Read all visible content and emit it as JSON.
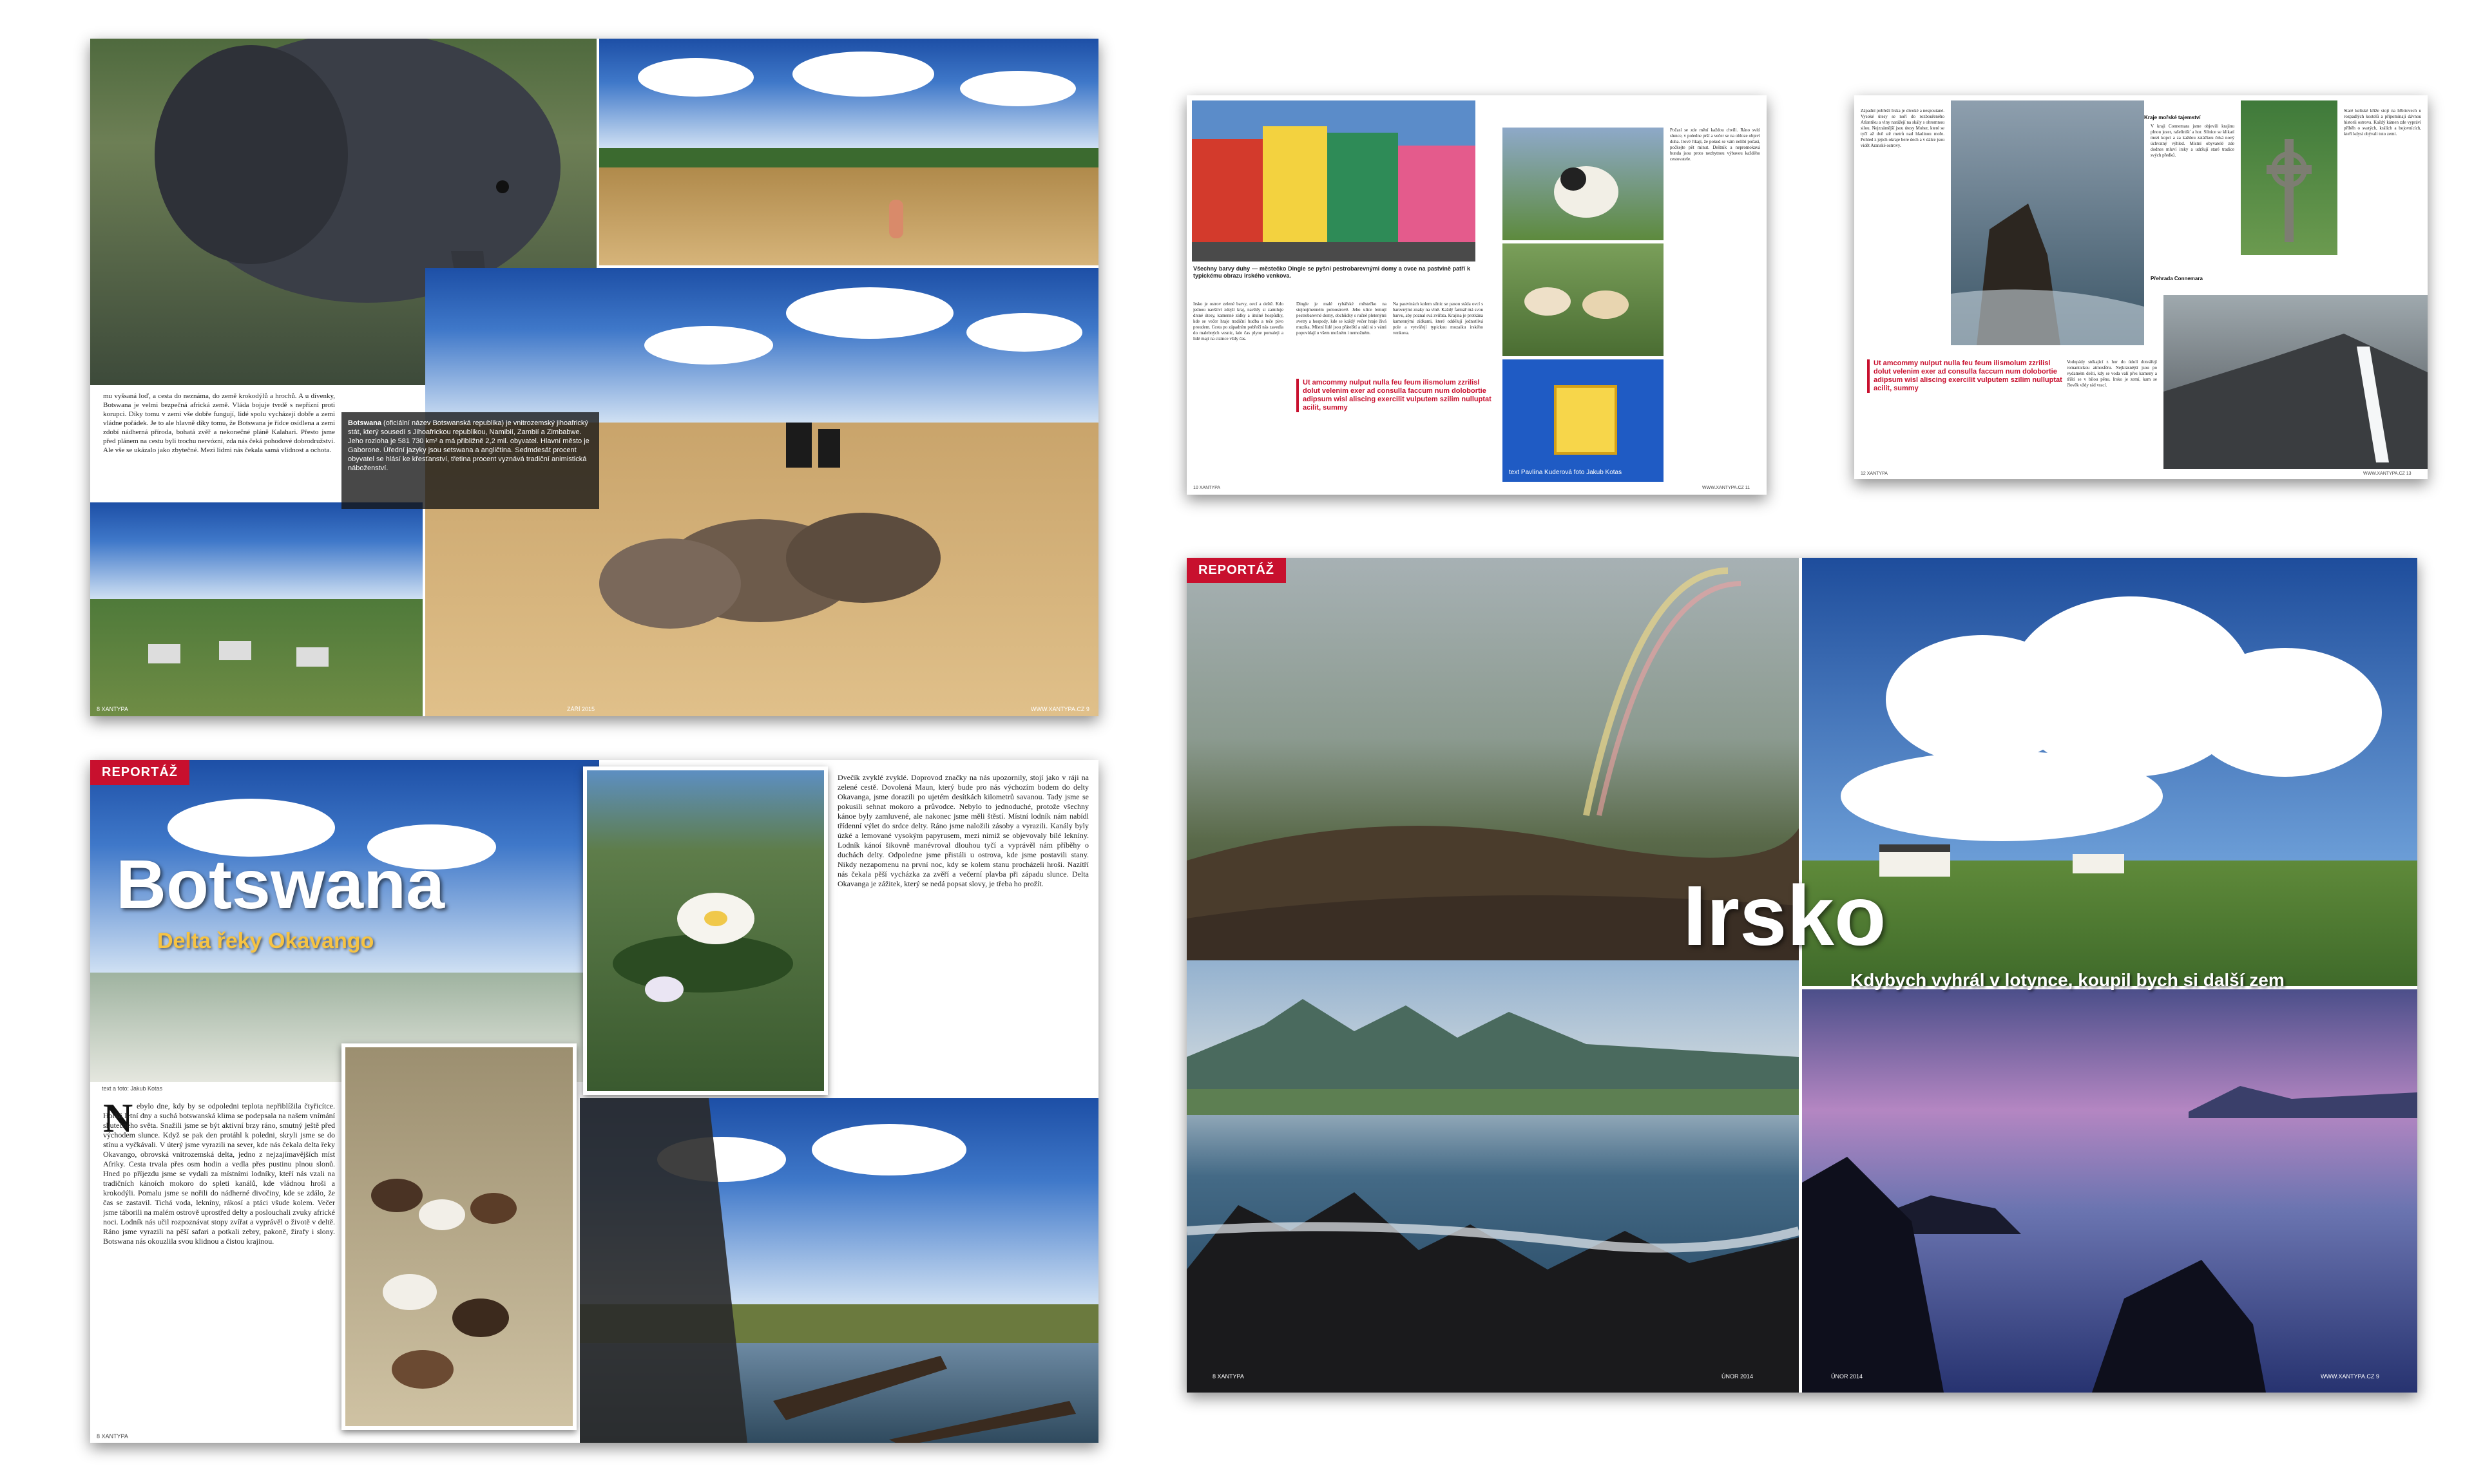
{
  "botswana_top": {
    "body_text": "mu vyšsaná loď, a cesta do neznáma, do země krokodýlů a hrochů. A u dívenky, Botswana je velmi bezpečná africká země. Vláda bojuje tvrdě s nepřízní proti korupci. Díky tomu v zemi vše dobře fungují, lidé spolu vycházejí dobře a zemi vládne pořádek. Je to ale hlavně díky tomu, že Botswana je řídce osídlena a zemi zdobí nádherná příroda, bohatá zvěř a nekonečné pláně Kalahari. Přesto jsme před plánem na cestu byli trochu nervózní, zda nás čeká pohodové dobrodružství. Ale vše se ukázalo jako zbytečné. Mezi lidmi nás čekala samá vlídnost a ochota.",
    "caption_lead": "Botswana",
    "caption": " (oficiální název Botswanská republika) je vnitrozemský jihoafrický stát, který sousedí s Jihoafrickou republikou, Namibií, Zambií a Zimbabwe. Jeho rozloha je 581 730 km² a má přibližně 2,2 mil. obyvatel. Hlavní město je Gaborone. Úřední jazyky jsou setswana a angličtina. Sedmdesát procent obyvatel se hlásí ke křesťanství, třetina procent vyznává tradiční animistická náboženství.",
    "folio_left": "8 XANTYPA",
    "folio_mid": "ZÁŘÍ 2015",
    "folio_right": "WWW.XANTYPA.CZ 9"
  },
  "botswana_bottom": {
    "tag": "REPORTÁŽ",
    "title": "Botswana",
    "subtitle": "Delta řeky Okavango",
    "credit": "text a foto: Jakub Kotas",
    "dropcap": "N",
    "body_left": "ebylo dne, kdy by se odpoledni teplota nepřiblížila čtyřicítce. Horká letní dny a suchá botswanská klima se podepsala na našem vnímání skutečného světa. Snažili jsme se být aktivní brzy ráno, smutný ještě před východem slunce. Když se pak den protáhl k poledni, skryli jsme se do stínu a vyčkávali. V úterý jsme vyrazili na sever, kde nás čekala delta řeky Okavango, obrovská vnitrozemská delta, jedno z nejzajímavějších míst Afriky. Cesta trvala přes osm hodin a vedla přes pustinu plnou slonů. Hned po příjezdu jsme se vydali za místními lodníky, kteří nás vzali na tradičních kánoích mokoro do spleti kanálů, kde vládnou hroši a krokodýli. Pomalu jsme se nořili do nádherné divočiny, kde se zdálo, že čas se zastavil. Tichá voda, lekníny, rákosí a ptáci všude kolem. Večer jsme táborili na malém ostrově uprostřed delty a poslouchali zvuky africké noci. Lodník nás učil rozpoznávat stopy zvířat a vyprávěl o životě v deltě. Ráno jsme vyrazili na pěší safari a potkali zebry, pakoně, žirafy i slony. Botswana nás okouzlila svou klidnou a čistou krajinou.",
    "body_right": "Dvečík zvyklé zvyklé. Doprovod značky na nás upozornily, stojí jako v ráji na zelené cestě. Dovolená Maun, který bude pro nás výchozím bodem do delty Okavanga, jsme dorazili po ujetém desítkách kilometrů savanou. Tady jsme se pokusili sehnat mokoro a průvodce. Nebylo to jednoduché, protože všechny kánoe byly zamluvené, ale nakonec jsme měli štěstí. Místní lodník nám nabídl třídenní výlet do srdce delty. Ráno jsme naložili zásoby a vyrazili. Kanály byly úzké a lemované vysokým papyrusem, mezi nimiž se objevovaly bílé lekníny. Lodník kánoí šikovně manévroval dlouhou tyčí a vyprávěl nám příběhy o duchách delty. Odpoledne jsme přistáli u ostrova, kde jsme postavili stany. Nikdy nezapomenu na první noc, kdy se kolem stanu procházeli hroši. Nazítří nás čekala pěší vycházka za zvěří a večerní plavba při západu slunce. Delta Okavanga je zážitek, který se nedá popsat slovy, je třeba ho prožít.",
    "folio_left": "8 XANTYPA"
  },
  "ireland_small1": {
    "caption": "Všechny barvy duhy — městečko Dingle se pyšní pestrobarevnými domy a ovce na pastvině patří k typickému obrazu irského venkova.",
    "pull_quote": "Ut amcommy nulput nulla feu feum ilismolum zzrilisl dolut velenim exer ad consulla faccum num dolobortie adipsum wisl aliscing exercilit vulputem szilim nulluptat acilit, summy",
    "credit": "text Pavlína Kuderová foto Jakub Kotas",
    "col1": "Irsko je ostrov zelené barvy, ovcí a deště. Kdo jednou navštíví zdejší kraj, navždy si zamiluje drsné útesy, kamenné zídky a útulné hospůdky, kde se večer hraje tradiční hudba a teče pivo proudem. Cesta po západním pobřeží nás zavedla do malebných vesnic, kde čas plyne pomaleji a lidé mají na cizince vždy čas.",
    "col2": "Dingle je malé rybářské městečko na stejnojmenném poloostrově. Jeho ulice lemují pestrobarevné domy, obchůdky s ručně pletenými svetry a hospody, kde se každý večer hraje živá muzika. Místní lidé jsou přátelští a rádi si s vámi popovídají o všem možném i nemožném.",
    "col3": "Na pastvinách kolem silnic se pasou stáda ovcí s barevnými znaky na vlně. Každý farmář má svou barvu, aby poznal svá zvířata. Krajina je protkána kamennými zídkami, které oddělují jednotlivá pole a vytvářejí typickou mozaiku irského venkova.",
    "col4": "Počasí se zde mění každou chvíli. Ráno svítí slunce, v poledne prší a večer se na obloze objeví duha. Irové říkají, že pokud se vám nelíbí počasí, počkejte pět minut. Deštník a nepromokavá bunda jsou proto nezbytnou výbavou každého cestovatele.",
    "folio_left": "10 XANTYPA",
    "folio_right": "WWW.XANTYPA.CZ 11"
  },
  "ireland_small2": {
    "pull_quote": "Ut amcommy nulput nulla feu feum ilismolum zzrilisl dolut velenim exer ad consulla faccum num dolobortie adipsum wisl aliscing exercilit vulputem szilim nulluptat acilit, summy",
    "heading1": "Kraje mořské tajemství",
    "heading2": "Přehrada Connemara",
    "col1": "Západní pobřeží Irska je divoké a nespoutané. Vysoké útesy se noří do rozbouřeného Atlantiku a vlny narážejí na skály s ohromnou silou. Nejznámější jsou útesy Moher, které se tyčí až dvě stě metrů nad hladinou moře. Pohled z jejich okraje bere dech a v dálce jsou vidět Aranské ostrovy.",
    "col2": "V kraji Connemara jsme objevili krajinu plnou jezer, rašelinišť a hor. Silnice se klikatí mezi kopci a za každou zatáčkou čeká nový úchvatný výhled. Místní obyvatelé zde dodnes mluví irsky a udržují staré tradice svých předků.",
    "col3": "Staré keltské kříže stojí na hřbitovech u rozpadlých kostelů a připomínají dávnou historii ostrova. Každý kámen zde vypráví příběh o svatých, králích a bojovnících, kteří kdysi obývali tuto zemi.",
    "col4": "Vodopády stékající z hor do údolí dotvářejí romantickou atmosféru. Nejkrásnější jsou po vydatném dešti, kdy se voda valí přes kameny a tříští se v bílou pěnu. Irsko je zemí, kam se člověk vždy rád vrací.",
    "folio_left": "12 XANTYPA",
    "folio_right": "WWW.XANTYPA.CZ 13"
  },
  "ireland_big": {
    "tag": "REPORTÁŽ",
    "title": "Irsko",
    "subtitle": "Kdybych vyhrál v lotynce, koupil bych si další zem",
    "folio_left": "8 XANTYPA",
    "folio_mid_left": "ÚNOR 2014",
    "folio_mid_right": "ÚNOR 2014",
    "folio_right": "WWW.XANTYPA.CZ 9"
  }
}
